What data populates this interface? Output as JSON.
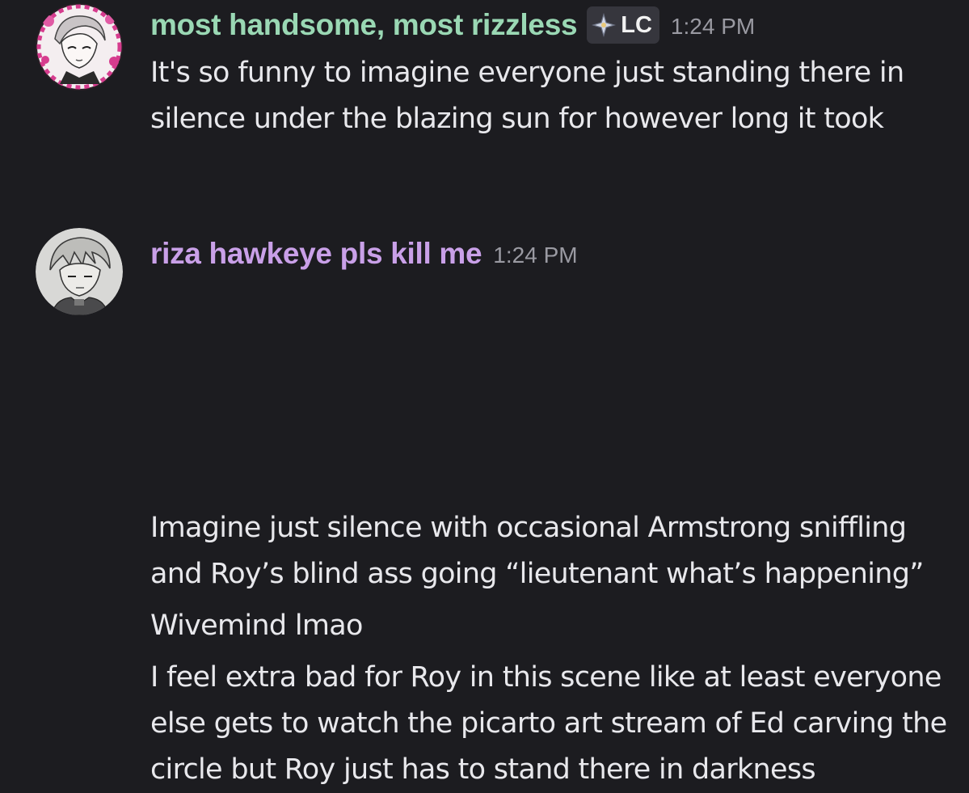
{
  "colors": {
    "background": "#1c1c20",
    "text": "#e8e8ec",
    "timestamp": "#9a9aa2",
    "badge_bg": "#36363d"
  },
  "messages": [
    {
      "author": "most handsome, most rizzless",
      "author_color": "#9ad8b4",
      "avatar_icon": "avatar-icon",
      "badge": {
        "icon": "sparkle-icon",
        "label": "LC"
      },
      "timestamp": "1:24 PM",
      "lines": [
        "It's so funny to imagine everyone just standing there in silence under the blazing sun for however long it took"
      ]
    },
    {
      "author": "riza hawkeye pls kill me",
      "author_color": "#c9a0e8",
      "avatar_icon": "avatar-icon",
      "timestamp": "1:24 PM",
      "lines": [
        "Imagine just silence with occasional Armstrong sniffling and Roy’s blind ass going “lieutenant what’s happening”",
        "Wivemind lmao",
        "I feel extra bad for Roy in this scene like at least everyone else gets to watch the picarto art stream of Ed carving the circle but Roy just has to stand there in darkness"
      ]
    }
  ]
}
